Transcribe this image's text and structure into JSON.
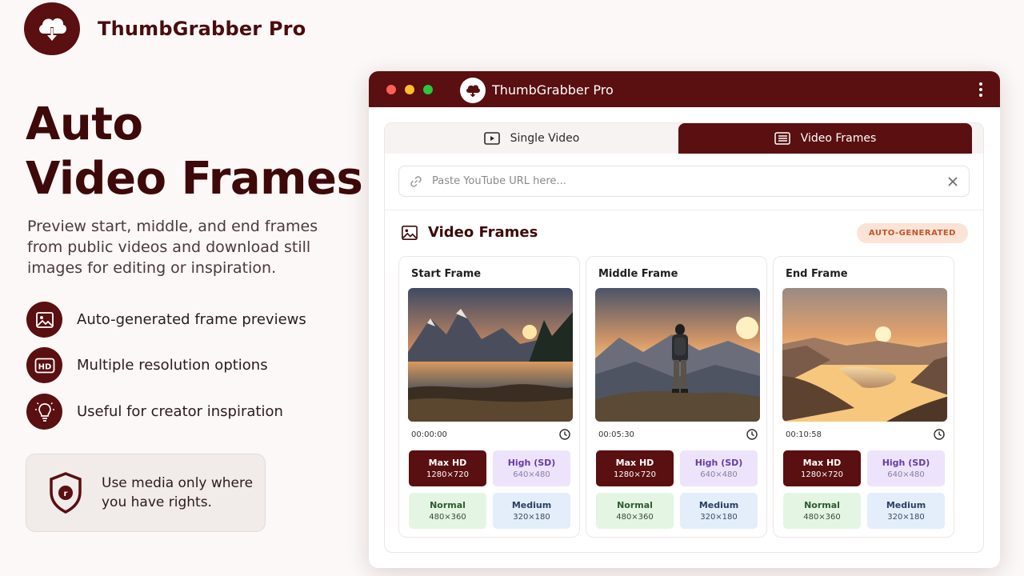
{
  "brand": {
    "name": "ThumbGrabber Pro"
  },
  "hero": {
    "title_line1": "Auto",
    "title_line2": "Video Frames",
    "description": "Preview start, middle, and end frames from public videos and download still images for editing or inspiration."
  },
  "features": [
    {
      "icon": "image-icon",
      "label": "Auto-generated frame previews"
    },
    {
      "icon": "hd-icon",
      "label": "Multiple resolution options"
    },
    {
      "icon": "lightbulb-icon",
      "label": "Useful for creator inspiration"
    }
  ],
  "notice": {
    "icon": "shield-icon",
    "text": "Use media only where you have rights."
  },
  "window": {
    "title": "ThumbGrabber Pro",
    "tabs": [
      {
        "label": "Single Video",
        "icon": "play-icon",
        "active": false
      },
      {
        "label": "Video Frames",
        "icon": "list-icon",
        "active": true
      }
    ],
    "url": {
      "placeholder": "Paste YouTube URL here...",
      "value": ""
    },
    "section_title": "Video Frames",
    "badge": "AUTO-GENERATED",
    "frames": [
      {
        "title": "Start Frame",
        "timestamp": "00:00:00",
        "scene": "mountain lake at sunset",
        "resolutions": [
          {
            "label": "Max HD",
            "dims": "1280×720"
          },
          {
            "label": "High (SD)",
            "dims": "640×480"
          },
          {
            "label": "Normal",
            "dims": "480×360"
          },
          {
            "label": "Medium",
            "dims": "320×180"
          }
        ]
      },
      {
        "title": "Middle Frame",
        "timestamp": "00:05:30",
        "scene": "hiker on mountain ridge",
        "resolutions": [
          {
            "label": "Max HD",
            "dims": "1280×720"
          },
          {
            "label": "High (SD)",
            "dims": "640×480"
          },
          {
            "label": "Normal",
            "dims": "480×360"
          },
          {
            "label": "Medium",
            "dims": "320×180"
          }
        ]
      },
      {
        "title": "End Frame",
        "timestamp": "00:10:58",
        "scene": "sunset valley with river",
        "resolutions": [
          {
            "label": "Max HD",
            "dims": "1280×720"
          },
          {
            "label": "High (SD)",
            "dims": "640×480"
          },
          {
            "label": "Normal",
            "dims": "480×360"
          },
          {
            "label": "Medium",
            "dims": "320×180"
          }
        ]
      }
    ]
  },
  "colors": {
    "brand": "#5a0f10",
    "badge_bg": "#fbe3d6",
    "badge_text": "#c2552d",
    "high_bg": "#ede4fb",
    "normal_bg": "#e4f5e4",
    "medium_bg": "#e4eefb"
  }
}
